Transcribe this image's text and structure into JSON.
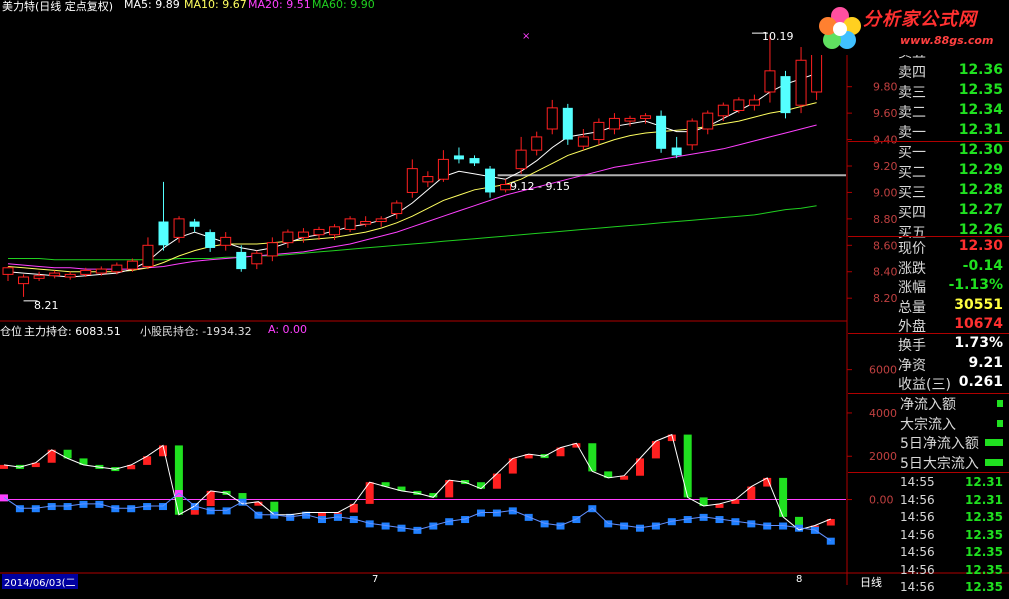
{
  "header": {
    "title": "美力特(日线 定点复权)",
    "ma5": "MA5: 9.89",
    "ma10": "MA10: 9.67",
    "ma20": "MA20: 9.51",
    "ma60": "MA60: 9.90"
  },
  "logo": {
    "title": "分析家公式网",
    "url": "www.88gs.com"
  },
  "indicator_header": {
    "name": "仓位",
    "main": "主力持仓: 6083.51",
    "retail": "小股民持仓: -1934.32",
    "a": "A: 0.00"
  },
  "colors": {
    "up": "#ff2020",
    "down": "#54ffff",
    "ma5": "#ffffff",
    "ma10": "#ffff60",
    "ma20": "#ff40ff",
    "ma60": "#20d020",
    "grid": "#b00000"
  },
  "quote": {
    "sells": [
      {
        "label": "卖五",
        "value": "12.37"
      },
      {
        "label": "卖四",
        "value": "12.36"
      },
      {
        "label": "卖三",
        "value": "12.35"
      },
      {
        "label": "卖二",
        "value": "12.34"
      },
      {
        "label": "卖一",
        "value": "12.31"
      }
    ],
    "buys": [
      {
        "label": "买一",
        "value": "12.30"
      },
      {
        "label": "买二",
        "value": "12.29"
      },
      {
        "label": "买三",
        "value": "12.28"
      },
      {
        "label": "买四",
        "value": "12.27"
      },
      {
        "label": "买五",
        "value": "12.26"
      }
    ],
    "stats": [
      {
        "label": "现价",
        "value": "12.30",
        "color": "#ff3030"
      },
      {
        "label": "涨跌",
        "value": "-0.14",
        "color": "#20e020"
      },
      {
        "label": "涨幅",
        "value": "-1.13%",
        "color": "#20e020"
      },
      {
        "label": "总量",
        "value": "30551",
        "color": "#ffff40"
      },
      {
        "label": "外盘",
        "value": "10674",
        "color": "#ff3030"
      }
    ],
    "stats2": [
      {
        "label": "换手",
        "value": "1.73%",
        "color": "#ffffff"
      },
      {
        "label": "净资",
        "value": "9.21",
        "color": "#ffffff"
      },
      {
        "label": "收益(三)",
        "value": "0.261",
        "color": "#ffffff"
      }
    ],
    "flows": [
      "净流入额",
      "大宗流入",
      "5日净流入额",
      "5日大宗流入"
    ],
    "ticks": [
      {
        "time": "14:55",
        "price": "12.31"
      },
      {
        "time": "14:56",
        "price": "12.31"
      },
      {
        "time": "14:56",
        "price": "12.35"
      },
      {
        "time": "14:56",
        "price": "12.35"
      },
      {
        "time": "14:56",
        "price": "12.35"
      },
      {
        "time": "14:56",
        "price": "12.35"
      },
      {
        "time": "14:56",
        "price": "12.35"
      }
    ]
  },
  "annotations": {
    "high": "10.19",
    "low": "8.21",
    "range": "9.12 - 9.15",
    "marker": "×"
  },
  "footer": {
    "date": "2014/06/03(二",
    "m1": "7",
    "m2": "8",
    "period": "日线"
  },
  "chart_data": {
    "price": {
      "type": "candlestick",
      "ylim": [
        8.05,
        10.35
      ],
      "ticks": [
        8.2,
        8.4,
        8.6,
        8.8,
        9.0,
        9.2,
        9.4,
        9.6,
        9.8
      ],
      "tick_labels": [
        "8.20",
        "8.40",
        "8.60",
        "8.80",
        "9.00",
        "9.20",
        "9.40",
        "9.60",
        "9.80"
      ],
      "candles": [
        [
          8.38,
          8.43,
          8.33,
          8.44
        ],
        [
          8.31,
          8.36,
          8.21,
          8.38
        ],
        [
          8.35,
          8.37,
          8.33,
          8.4
        ],
        [
          8.37,
          8.39,
          8.35,
          8.41
        ],
        [
          8.36,
          8.38,
          8.34,
          8.4
        ],
        [
          8.38,
          8.41,
          8.36,
          8.43
        ],
        [
          8.39,
          8.42,
          8.37,
          8.44
        ],
        [
          8.4,
          8.45,
          8.38,
          8.47
        ],
        [
          8.42,
          8.48,
          8.4,
          8.5
        ],
        [
          8.44,
          8.6,
          8.42,
          8.66
        ],
        [
          8.78,
          8.6,
          8.56,
          9.08
        ],
        [
          8.66,
          8.8,
          8.62,
          8.82
        ],
        [
          8.78,
          8.74,
          8.7,
          8.8
        ],
        [
          8.7,
          8.58,
          8.55,
          8.72
        ],
        [
          8.6,
          8.66,
          8.56,
          8.7
        ],
        [
          8.55,
          8.42,
          8.4,
          8.6
        ],
        [
          8.46,
          8.54,
          8.42,
          8.56
        ],
        [
          8.52,
          8.62,
          8.48,
          8.66
        ],
        [
          8.62,
          8.7,
          8.58,
          8.72
        ],
        [
          8.66,
          8.7,
          8.62,
          8.73
        ],
        [
          8.68,
          8.72,
          8.64,
          8.74
        ],
        [
          8.68,
          8.74,
          8.64,
          8.76
        ],
        [
          8.72,
          8.8,
          8.7,
          8.82
        ],
        [
          8.76,
          8.78,
          8.74,
          8.82
        ],
        [
          8.78,
          8.8,
          8.74,
          8.82
        ],
        [
          8.84,
          8.92,
          8.8,
          8.94
        ],
        [
          9.0,
          9.18,
          8.96,
          9.25
        ],
        [
          9.08,
          9.12,
          9.04,
          9.16
        ],
        [
          9.1,
          9.25,
          9.08,
          9.32
        ],
        [
          9.28,
          9.25,
          9.22,
          9.34
        ],
        [
          9.26,
          9.22,
          9.2,
          9.28
        ],
        [
          9.18,
          9.0,
          8.96,
          9.2
        ],
        [
          9.02,
          9.06,
          9.0,
          9.1
        ],
        [
          9.18,
          9.32,
          9.14,
          9.42
        ],
        [
          9.32,
          9.42,
          9.28,
          9.46
        ],
        [
          9.48,
          9.64,
          9.44,
          9.7
        ],
        [
          9.64,
          9.4,
          9.36,
          9.67
        ],
        [
          9.35,
          9.42,
          9.32,
          9.48
        ],
        [
          9.4,
          9.53,
          9.36,
          9.56
        ],
        [
          9.48,
          9.56,
          9.44,
          9.6
        ],
        [
          9.54,
          9.56,
          9.5,
          9.58
        ],
        [
          9.56,
          9.58,
          9.52,
          9.6
        ],
        [
          9.58,
          9.33,
          9.3,
          9.62
        ],
        [
          9.34,
          9.28,
          9.26,
          9.42
        ],
        [
          9.36,
          9.54,
          9.32,
          9.56
        ],
        [
          9.48,
          9.6,
          9.44,
          9.62
        ],
        [
          9.58,
          9.66,
          9.54,
          9.68
        ],
        [
          9.62,
          9.7,
          9.6,
          9.72
        ],
        [
          9.66,
          9.7,
          9.62,
          9.74
        ],
        [
          9.76,
          9.92,
          9.68,
          10.19
        ],
        [
          9.88,
          9.6,
          9.56,
          9.92
        ],
        [
          9.66,
          10.0,
          9.6,
          10.1
        ],
        [
          9.76,
          10.05,
          9.7,
          10.1
        ]
      ],
      "ma5": [
        8.4,
        8.39,
        8.38,
        8.37,
        8.36,
        8.37,
        8.38,
        8.39,
        8.42,
        8.48,
        8.58,
        8.66,
        8.7,
        8.66,
        8.62,
        8.58,
        8.56,
        8.58,
        8.62,
        8.66,
        8.68,
        8.71,
        8.74,
        8.76,
        8.79,
        8.84,
        8.92,
        9.02,
        9.12,
        9.16,
        9.14,
        9.12,
        9.1,
        9.16,
        9.24,
        9.34,
        9.42,
        9.44,
        9.46,
        9.5,
        9.52,
        9.54,
        9.5,
        9.46,
        9.46,
        9.5,
        9.56,
        9.62,
        9.68,
        9.76,
        9.82,
        9.86,
        9.9
      ],
      "ma10": [
        8.44,
        8.43,
        8.42,
        8.41,
        8.4,
        8.4,
        8.4,
        8.4,
        8.41,
        8.43,
        8.47,
        8.52,
        8.56,
        8.59,
        8.61,
        8.61,
        8.61,
        8.62,
        8.63,
        8.64,
        8.65,
        8.66,
        8.68,
        8.7,
        8.73,
        8.77,
        8.82,
        8.88,
        8.94,
        8.98,
        9.02,
        9.04,
        9.06,
        9.1,
        9.16,
        9.22,
        9.28,
        9.32,
        9.36,
        9.4,
        9.43,
        9.45,
        9.46,
        9.47,
        9.48,
        9.5,
        9.52,
        9.54,
        9.57,
        9.6,
        9.62,
        9.65,
        9.68
      ],
      "ma20": [
        8.46,
        8.45,
        8.44,
        8.43,
        8.43,
        8.42,
        8.42,
        8.42,
        8.42,
        8.43,
        8.44,
        8.46,
        8.48,
        8.49,
        8.5,
        8.51,
        8.52,
        8.53,
        8.54,
        8.55,
        8.57,
        8.59,
        8.61,
        8.64,
        8.67,
        8.7,
        8.74,
        8.78,
        8.82,
        8.86,
        8.9,
        8.94,
        8.98,
        9.01,
        9.04,
        9.07,
        9.1,
        9.13,
        9.16,
        9.19,
        9.21,
        9.23,
        9.25,
        9.27,
        9.29,
        9.31,
        9.33,
        9.36,
        9.39,
        9.42,
        9.45,
        9.48,
        9.51
      ],
      "ma60": [
        8.5,
        8.5,
        8.5,
        8.49,
        8.49,
        8.49,
        8.49,
        8.49,
        8.49,
        8.49,
        8.49,
        8.5,
        8.5,
        8.5,
        8.51,
        8.51,
        8.52,
        8.52,
        8.53,
        8.54,
        8.55,
        8.56,
        8.57,
        8.58,
        8.59,
        8.6,
        8.61,
        8.62,
        8.63,
        8.64,
        8.65,
        8.66,
        8.67,
        8.68,
        8.69,
        8.7,
        8.71,
        8.72,
        8.73,
        8.74,
        8.75,
        8.76,
        8.77,
        8.78,
        8.79,
        8.8,
        8.81,
        8.82,
        8.83,
        8.85,
        8.87,
        8.88,
        8.9
      ],
      "support_line": 9.13
    },
    "indicator": {
      "type": "bar",
      "ylim": [
        -3300,
        7600
      ],
      "ticks": [
        0,
        2000,
        4000,
        6000
      ],
      "tick_labels": [
        "0.00",
        "2000",
        "4000",
        "6000"
      ],
      "main": [
        1600,
        1500,
        1700,
        2300,
        1900,
        1600,
        1500,
        1400,
        1600,
        2000,
        2500,
        -700,
        -300,
        400,
        300,
        -200,
        -100,
        -700,
        -700,
        -600,
        -600,
        -600,
        -200,
        800,
        600,
        400,
        300,
        100,
        900,
        800,
        500,
        1200,
        1900,
        2100,
        2000,
        2400,
        2600,
        1300,
        1000,
        1100,
        1900,
        2700,
        3000,
        100,
        -300,
        -200,
        0,
        600,
        1000,
        -800,
        -1400,
        -1200,
        -900
      ],
      "retail": [
        100,
        -400,
        -400,
        -300,
        -300,
        -200,
        -200,
        -400,
        -400,
        -300,
        -300,
        300,
        -300,
        -500,
        -500,
        -100,
        -700,
        -700,
        -800,
        -700,
        -900,
        -800,
        -900,
        -1100,
        -1200,
        -1300,
        -1400,
        -1200,
        -1000,
        -900,
        -600,
        -600,
        -500,
        -800,
        -1100,
        -1200,
        -900,
        -400,
        -1100,
        -1200,
        -1300,
        -1200,
        -1000,
        -900,
        -800,
        -900,
        -1000,
        -1100,
        -1200,
        -1200,
        -1300,
        -1400,
        -1900
      ],
      "line": [
        1650,
        1520,
        1580,
        2250,
        1950,
        1620,
        1520,
        1440,
        1580,
        1980,
        2400,
        0,
        350,
        600,
        350,
        200,
        250,
        1200,
        1100,
        1300,
        1200,
        1100,
        1250,
        1450,
        1750,
        2150,
        2450,
        2550,
        2600,
        2700,
        1100,
        1150,
        1700,
        1900,
        1950,
        2150,
        1900,
        1300,
        1000,
        1500,
        1100,
        1300,
        1700,
        -150,
        -250,
        -200,
        100,
        1600,
        3150,
        4250,
        3000,
        4900,
        6050
      ],
      "line_cols": [
        0,
        2,
        4,
        6,
        8,
        10,
        12,
        14,
        16,
        18,
        20,
        22,
        24,
        26,
        28,
        30,
        32,
        34,
        36,
        38,
        40,
        42,
        44,
        46,
        48,
        50,
        52,
        54,
        56,
        58,
        60,
        62,
        64,
        66,
        68,
        70,
        72,
        74,
        76,
        78,
        80,
        82,
        84,
        86,
        88,
        90,
        92,
        94,
        96,
        98,
        100,
        102,
        104
      ]
    }
  }
}
